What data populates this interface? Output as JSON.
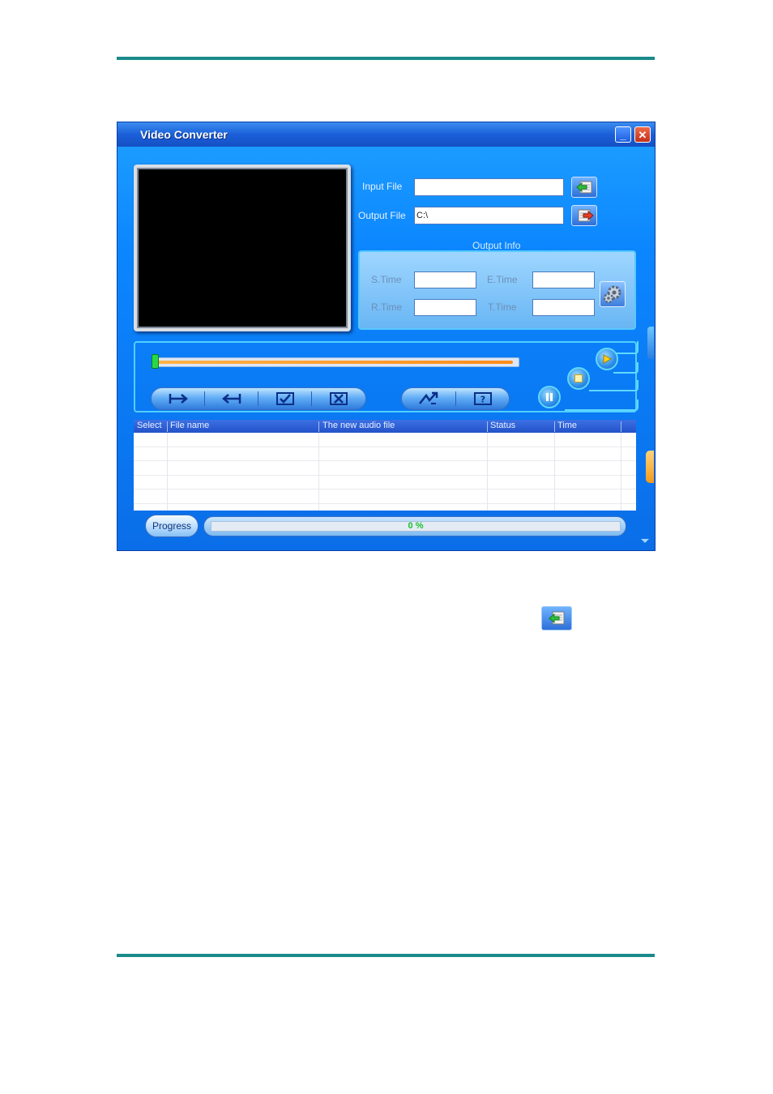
{
  "window": {
    "title": "Video Converter",
    "minimize_glyph": "_",
    "close_glyph": "✕"
  },
  "files": {
    "input_label": "Input File",
    "input_value": "",
    "output_label": "Output File",
    "output_value": "C:\\",
    "input_icon": "folder-input-icon",
    "output_icon": "folder-output-icon"
  },
  "output_info": {
    "label": "Output Info",
    "stime_label": "S.Time",
    "etime_label": "E.Time",
    "rtime_label": "R.Time",
    "ttime_label": "T.Time",
    "stime_value": "",
    "etime_value": "",
    "rtime_value": "",
    "ttime_value": "",
    "settings_icon": "gear-icon"
  },
  "controls": {
    "seek_position": 0,
    "buttons": [
      "mark-in-icon",
      "mark-out-icon",
      "select-all-icon",
      "clear-selection-icon",
      "convert-icon",
      "help-icon",
      "play-icon",
      "stop-icon",
      "pause-icon"
    ]
  },
  "table": {
    "columns": [
      "Select",
      "File name",
      "The new audio file",
      "Status",
      "Time"
    ],
    "rows": []
  },
  "progress": {
    "button_label": "Progress",
    "percent_text": "0 %",
    "value": 0
  },
  "colors": {
    "accent": "#0b86ff",
    "rule": "#1a8a8a",
    "progress_text": "#19c02a"
  }
}
